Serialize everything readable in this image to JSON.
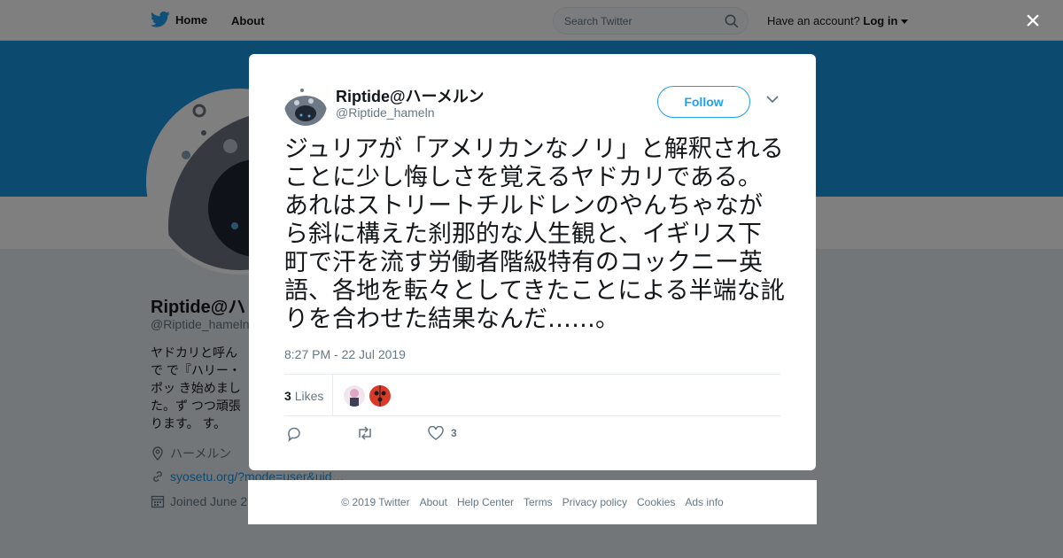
{
  "nav": {
    "home_label": "Home",
    "about_label": "About",
    "search_placeholder": "Search Twitter",
    "have_account": "Have an account?",
    "login_label": "Log in",
    "close_glyph": "×"
  },
  "profile": {
    "name": "Riptide@ハ",
    "handle": "@Riptide_hameln",
    "bio": "ヤドカリと呼んで で『ハリー・ポッ き始めました。ず つつ頑張ります。 す。",
    "location": "ハーメルン",
    "link": "syosetu.org/?mode=user&uid…",
    "joined": "Joined June 2"
  },
  "tweet": {
    "author_name": "Riptide@ハーメルン",
    "author_handle": "@Riptide_hameln",
    "follow_label": "Follow",
    "text": "ジュリアが「アメリカンなノリ」と解釈されることに少し悔しさを覚えるヤドカリである。あれはストリートチルドレンのやんちゃながら斜に構えた刹那的な人生観と、イギリス下町で汗を流す労働者階級特有のコックニー英語、各地を転々としてきたことによる半端な訛りを合わせた結果なんだ……。",
    "timestamp": "8:27 PM - 22 Jul 2019",
    "likes_count": "3",
    "likes_label": "Likes",
    "like_action_count": "3"
  },
  "footer": {
    "copyright": "© 2019 Twitter",
    "about": "About",
    "help": "Help Center",
    "terms": "Terms",
    "privacy": "Privacy policy",
    "cookies": "Cookies",
    "ads": "Ads info"
  },
  "colors": {
    "brand": "#1da1f2",
    "banner": "#1b95e0",
    "background": "#e6ecf0"
  },
  "icons": [
    "twitter-bird-icon",
    "search-icon",
    "close-icon",
    "chevron-down-icon",
    "reply-icon",
    "retweet-icon",
    "heart-icon",
    "location-icon",
    "link-icon",
    "calendar-icon"
  ]
}
